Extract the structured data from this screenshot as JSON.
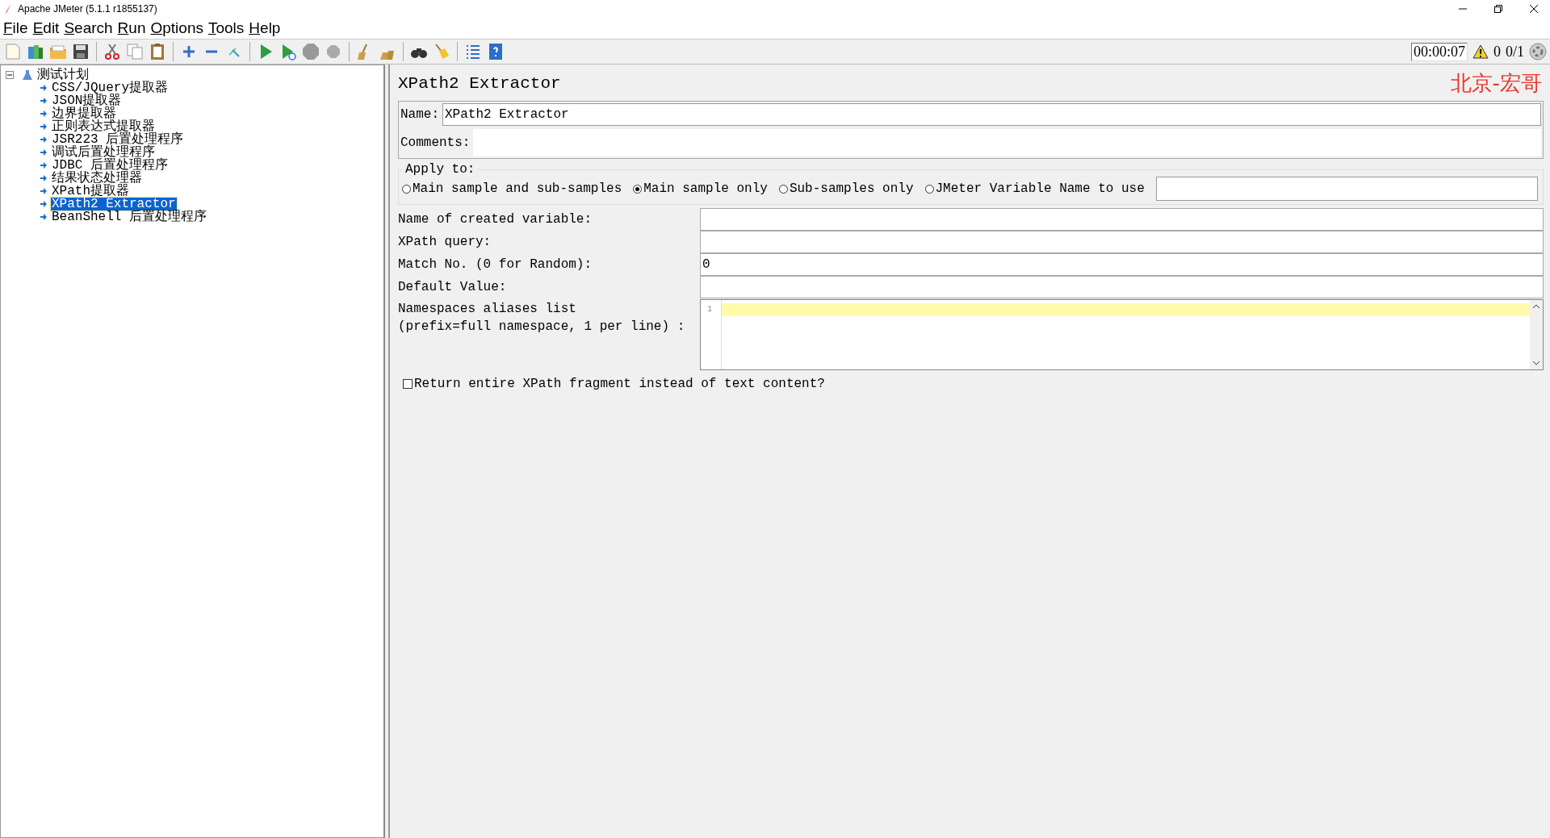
{
  "window": {
    "title": "Apache JMeter (5.1.1 r1855137)"
  },
  "menu": [
    {
      "label": "File"
    },
    {
      "label": "Edit"
    },
    {
      "label": "Search"
    },
    {
      "label": "Run"
    },
    {
      "label": "Options"
    },
    {
      "label": "Tools"
    },
    {
      "label": "Help"
    }
  ],
  "status": {
    "timer": "00:00:07",
    "warnings": "0",
    "threads": "0/1"
  },
  "tree": {
    "label": "测试计划",
    "expanded": true,
    "selected": false,
    "children": [
      {
        "label": "CSS/JQuery提取器",
        "selected": false
      },
      {
        "label": "JSON提取器",
        "selected": false
      },
      {
        "label": "边界提取器",
        "selected": false
      },
      {
        "label": "正则表达式提取器",
        "selected": false
      },
      {
        "label": "JSR223 后置处理程序",
        "selected": false
      },
      {
        "label": "调试后置处理程序",
        "selected": false
      },
      {
        "label": "JDBC 后置处理程序",
        "selected": false
      },
      {
        "label": "结果状态处理器",
        "selected": false
      },
      {
        "label": "XPath提取器",
        "selected": false
      },
      {
        "label": "XPath2 Extractor",
        "selected": true
      },
      {
        "label": "BeanShell 后置处理程序",
        "selected": false
      }
    ]
  },
  "panel": {
    "title": "XPath2 Extractor",
    "author_label": "北京-宏哥",
    "name_label": "Name:",
    "name_value": "XPath2 Extractor",
    "comments_label": "Comments:",
    "apply_to": {
      "legend": "Apply to:",
      "options": [
        {
          "label": "Main sample and sub-samples",
          "selected": false
        },
        {
          "label": "Main sample only",
          "selected": true
        },
        {
          "label": "Sub-samples only",
          "selected": false
        },
        {
          "label": "JMeter Variable Name to use",
          "selected": false
        }
      ]
    },
    "fields": [
      {
        "label": "Name of created variable:"
      },
      {
        "label": "XPath query:"
      },
      {
        "label": "Match No. (0 for Random):",
        "value": "0"
      },
      {
        "label": "Default Value:"
      }
    ],
    "namespaces": {
      "label": "Namespaces aliases list\n(prefix=full namespace, 1 per line) :",
      "line_number": "1"
    },
    "return_fragment": {
      "label": "Return entire XPath fragment instead of text content?",
      "checked": false
    }
  }
}
